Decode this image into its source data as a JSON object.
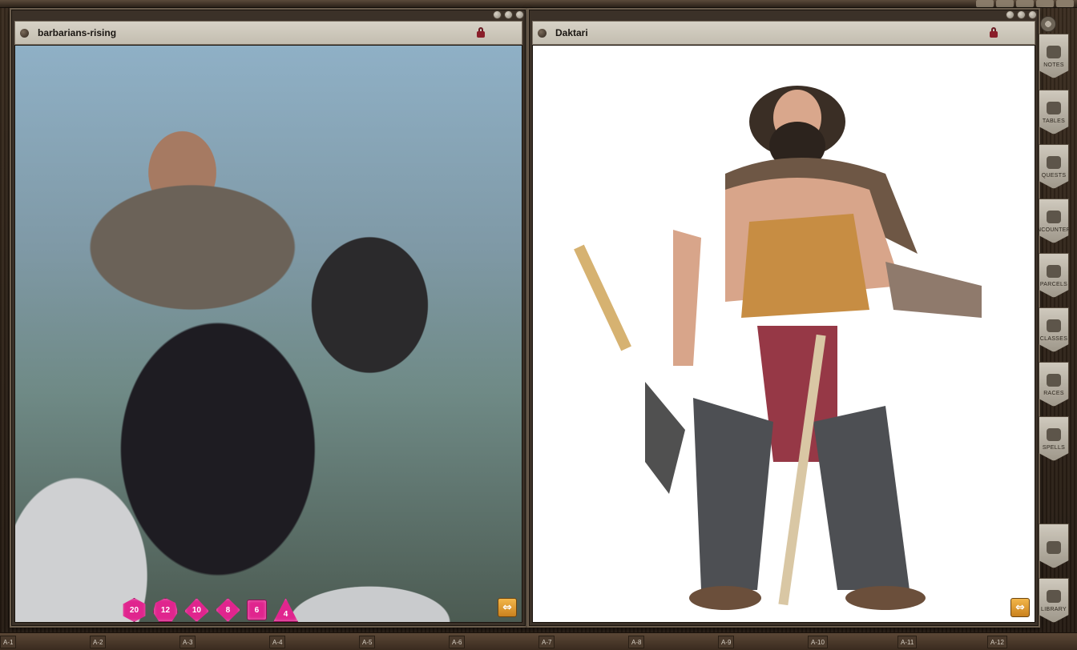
{
  "windows": [
    {
      "title": "barbarians-rising"
    },
    {
      "title": "Daktari"
    }
  ],
  "dice": [
    {
      "type": "d20",
      "label": "20"
    },
    {
      "type": "d12",
      "label": "12"
    },
    {
      "type": "d10",
      "label": "10"
    },
    {
      "type": "d8",
      "label": "8"
    },
    {
      "type": "d6",
      "label": "6"
    },
    {
      "type": "d4",
      "label": "4"
    }
  ],
  "sidebar": {
    "items": [
      {
        "label": "NOTES",
        "icon": "feather-icon"
      },
      {
        "label": "TABLES",
        "icon": "table-icon"
      },
      {
        "label": "QUESTS",
        "icon": "quest-icon"
      },
      {
        "label": "ENCOUNTERS",
        "icon": "skull-icon"
      },
      {
        "label": "PARCELS",
        "icon": "parcel-icon"
      },
      {
        "label": "CLASSES",
        "icon": "helmet-icon"
      },
      {
        "label": "RACES",
        "icon": "race-icon"
      },
      {
        "label": "SPELLS",
        "icon": "spell-icon"
      },
      {
        "label": "",
        "icon": "castle-icon"
      },
      {
        "label": "LIBRARY",
        "icon": "library-icon"
      }
    ]
  },
  "hotbar": [
    "A-1",
    "A-2",
    "A-3",
    "A-4",
    "A-5",
    "A-6",
    "A-7",
    "A-8",
    "A-9",
    "A-10",
    "A-11",
    "A-12"
  ],
  "colors": {
    "dice": "#e0258e",
    "expand_button": "#f3b64a",
    "lock": "#8a1e2a"
  }
}
